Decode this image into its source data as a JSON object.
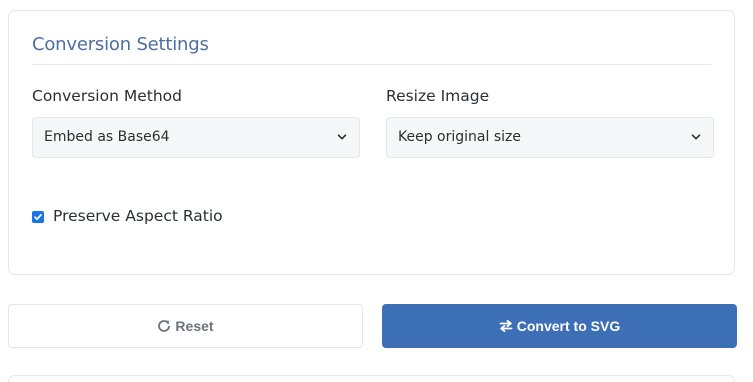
{
  "card": {
    "title": "Conversion Settings"
  },
  "fields": {
    "method": {
      "label": "Conversion Method",
      "selected": "Embed as Base64"
    },
    "resize": {
      "label": "Resize Image",
      "selected": "Keep original size"
    }
  },
  "checkbox": {
    "label": "Preserve Aspect Ratio",
    "checked": true
  },
  "buttons": {
    "reset": "Reset",
    "convert": "Convert to SVG"
  },
  "colors": {
    "accent": "#3d6fb6",
    "title": "#4a6fa5",
    "checkbox": "#1a73e8"
  },
  "icons": {
    "select": "chevron-down-icon",
    "checkbox": "check-icon",
    "reset": "redo-icon",
    "convert": "exchange-icon"
  }
}
